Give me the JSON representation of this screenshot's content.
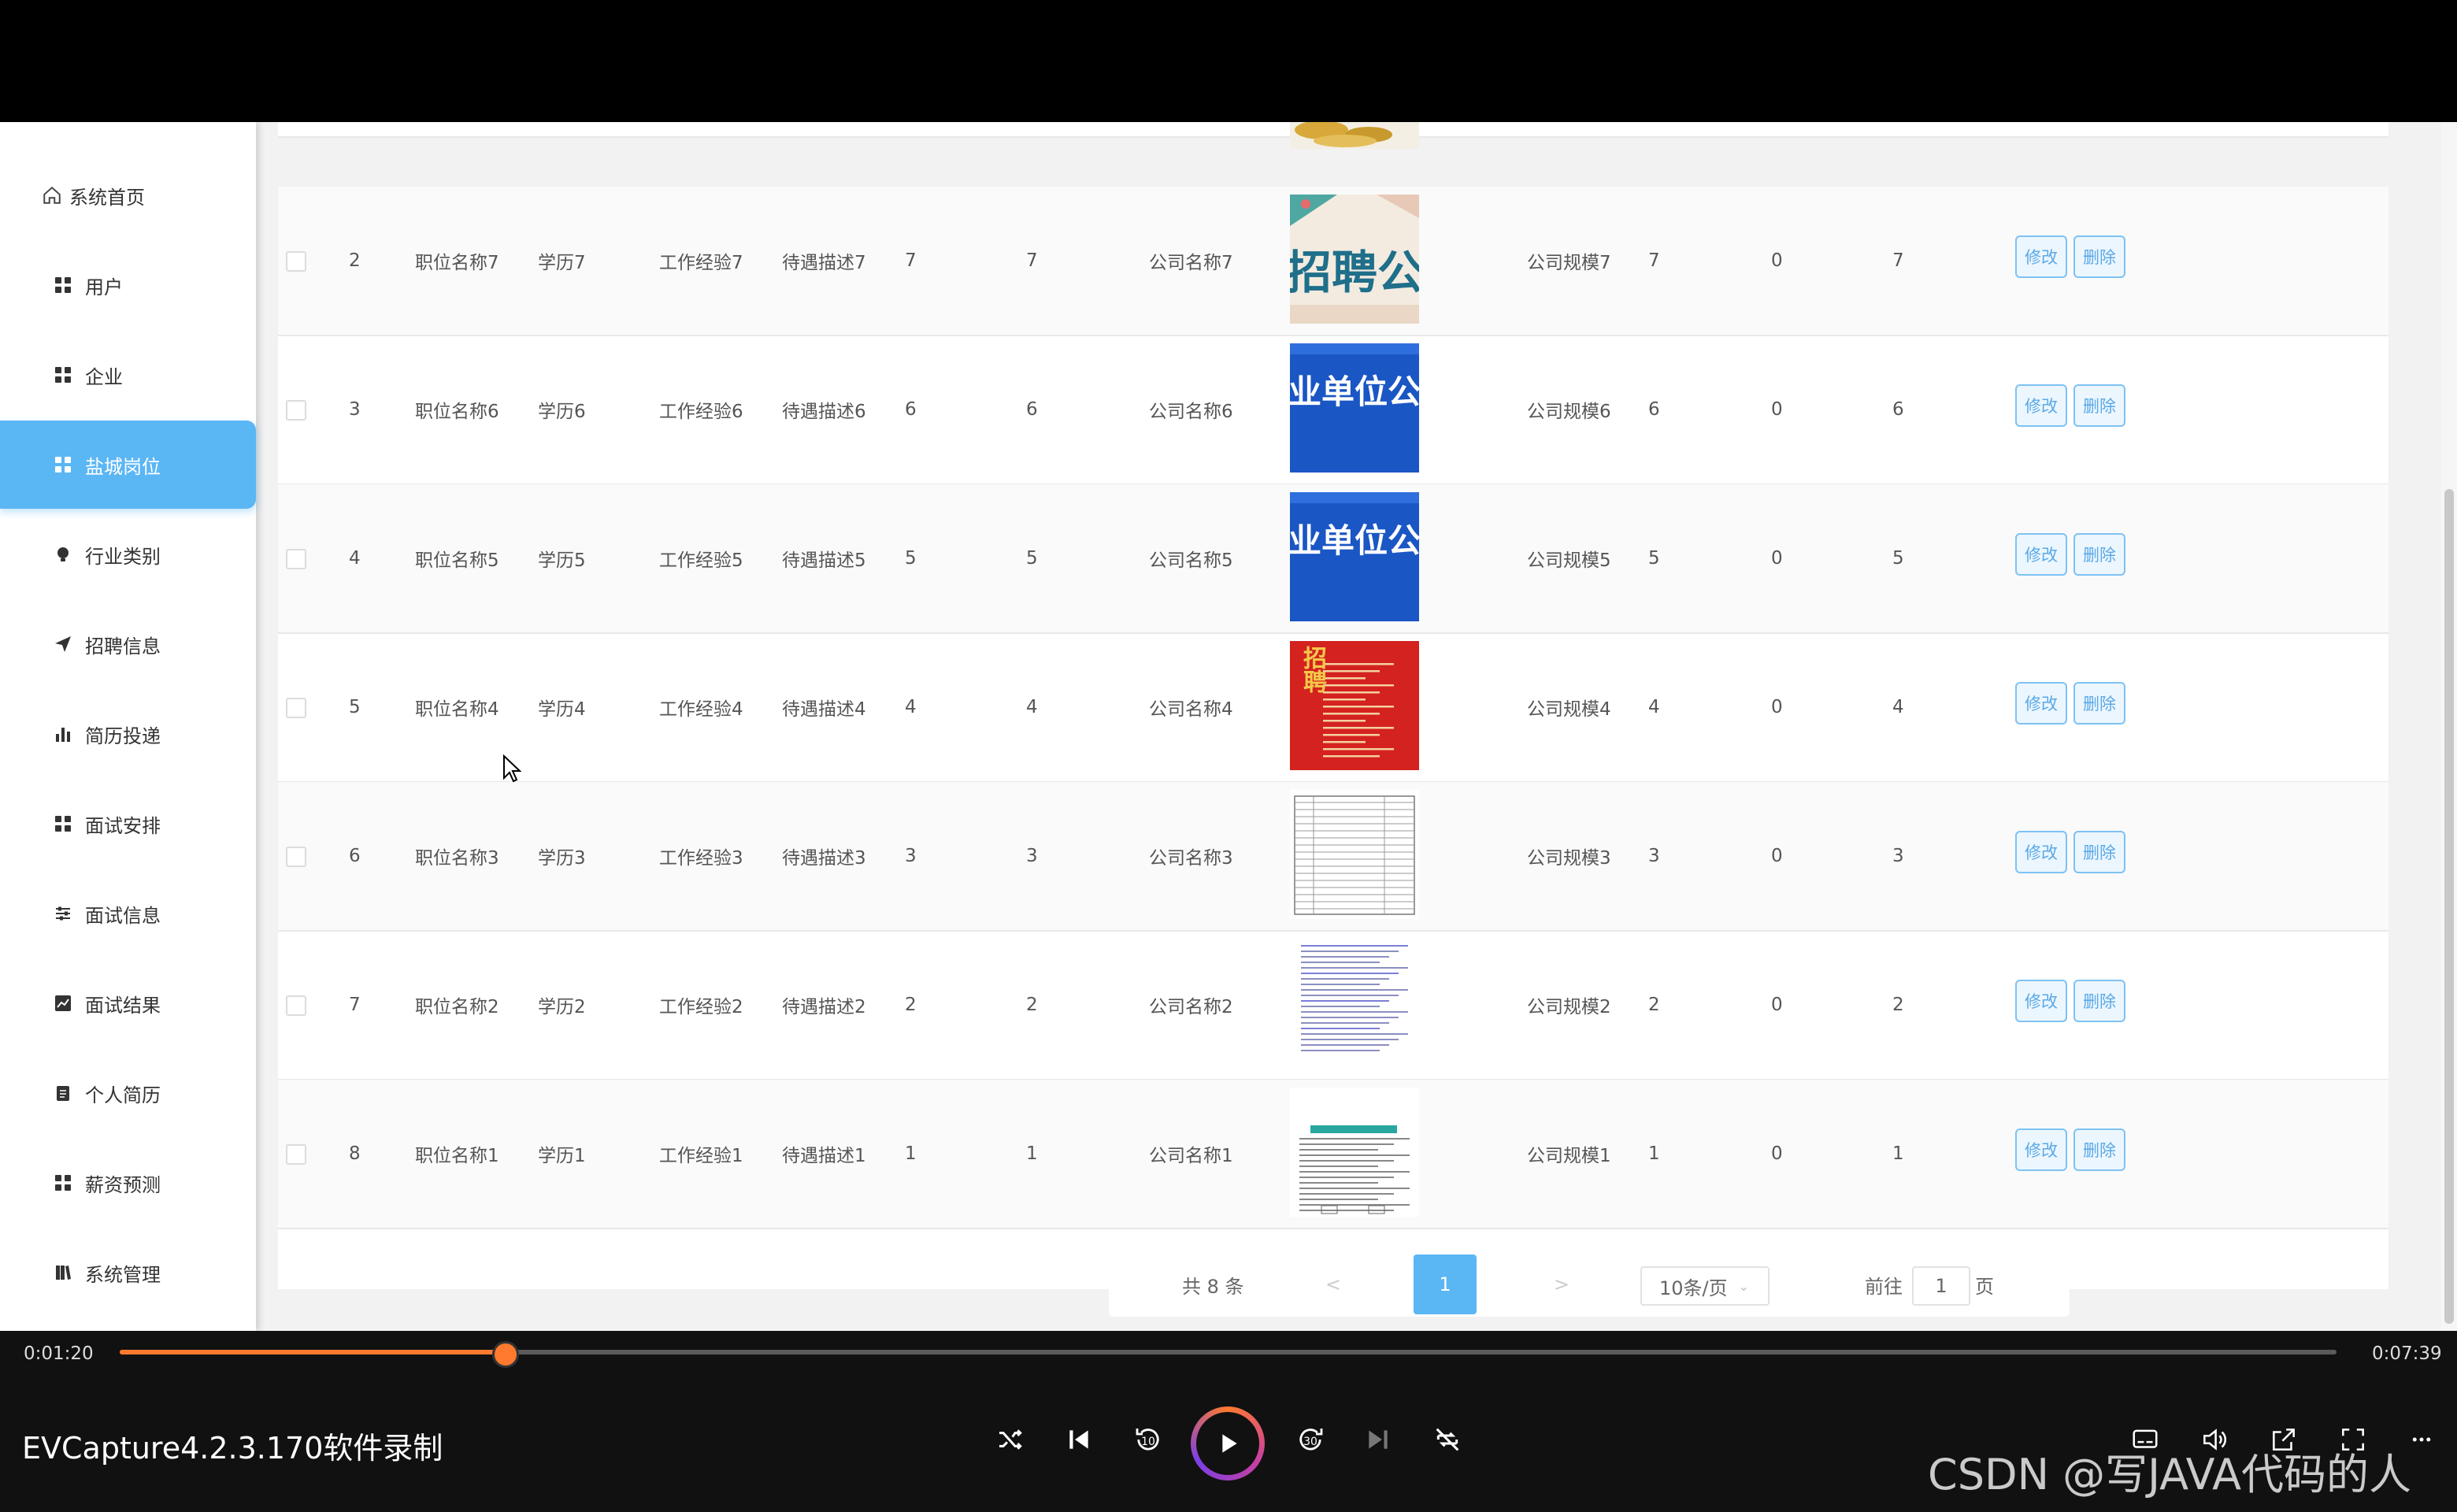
{
  "sidebar": {
    "items": [
      {
        "label": "系统首页",
        "icon": "home-icon"
      },
      {
        "label": "用户",
        "icon": "grid-icon"
      },
      {
        "label": "企业",
        "icon": "grid-icon"
      },
      {
        "label": "盐城岗位",
        "icon": "grid-icon",
        "active": true
      },
      {
        "label": "行业类别",
        "icon": "lightbulb-icon"
      },
      {
        "label": "招聘信息",
        "icon": "paper-plane-icon"
      },
      {
        "label": "简历投递",
        "icon": "bar-chart-icon"
      },
      {
        "label": "面试安排",
        "icon": "grid-icon"
      },
      {
        "label": "面试信息",
        "icon": "sliders-icon"
      },
      {
        "label": "面试结果",
        "icon": "line-chart-icon"
      },
      {
        "label": "个人简历",
        "icon": "clipboard-icon"
      },
      {
        "label": "薪资预测",
        "icon": "grid-icon"
      },
      {
        "label": "系统管理",
        "icon": "book-icon"
      }
    ]
  },
  "table": {
    "rows": [
      {
        "index": "2",
        "title": "职位名称7",
        "edu": "学历7",
        "exp": "工作经验7",
        "benefit": "待遇描述7",
        "n1": "7",
        "n2": "7",
        "company": "公司名称7",
        "scale": "公司规模7",
        "n3": "7",
        "n4": "0",
        "n5": "7",
        "thumb_text": "招聘公",
        "thumb_style": "poster-teal"
      },
      {
        "index": "3",
        "title": "职位名称6",
        "edu": "学历6",
        "exp": "工作经验6",
        "benefit": "待遇描述6",
        "n1": "6",
        "n2": "6",
        "company": "公司名称6",
        "scale": "公司规模6",
        "n3": "6",
        "n4": "0",
        "n5": "6",
        "thumb_text": "业单位公",
        "thumb_style": "poster-blue"
      },
      {
        "index": "4",
        "title": "职位名称5",
        "edu": "学历5",
        "exp": "工作经验5",
        "benefit": "待遇描述5",
        "n1": "5",
        "n2": "5",
        "company": "公司名称5",
        "scale": "公司规模5",
        "n3": "5",
        "n4": "0",
        "n5": "5",
        "thumb_text": "业单位公",
        "thumb_style": "poster-blue"
      },
      {
        "index": "5",
        "title": "职位名称4",
        "edu": "学历4",
        "exp": "工作经验4",
        "benefit": "待遇描述4",
        "n1": "4",
        "n2": "4",
        "company": "公司名称4",
        "scale": "公司规模4",
        "n3": "4",
        "n4": "0",
        "n5": "4",
        "thumb_text": "招聘",
        "thumb_style": "poster-red"
      },
      {
        "index": "6",
        "title": "职位名称3",
        "edu": "学历3",
        "exp": "工作经验3",
        "benefit": "待遇描述3",
        "n1": "3",
        "n2": "3",
        "company": "公司名称3",
        "scale": "公司规模3",
        "n3": "3",
        "n4": "0",
        "n5": "3",
        "thumb_text": "",
        "thumb_style": "doc-table"
      },
      {
        "index": "7",
        "title": "职位名称2",
        "edu": "学历2",
        "exp": "工作经验2",
        "benefit": "待遇描述2",
        "n1": "2",
        "n2": "2",
        "company": "公司名称2",
        "scale": "公司规模2",
        "n3": "2",
        "n4": "0",
        "n5": "2",
        "thumb_text": "",
        "thumb_style": "doc-text"
      },
      {
        "index": "8",
        "title": "职位名称1",
        "edu": "学历1",
        "exp": "工作经验1",
        "benefit": "待遇描述1",
        "n1": "1",
        "n2": "1",
        "company": "公司名称1",
        "scale": "公司规模1",
        "n3": "1",
        "n4": "0",
        "n5": "1",
        "thumb_text": "",
        "thumb_style": "doc-form"
      }
    ],
    "edit_label": "修改",
    "delete_label": "删除"
  },
  "pagination": {
    "total": "共 8 条",
    "prev": "<",
    "current": "1",
    "next": ">",
    "page_size": "10条/页",
    "goto_prefix": "前往",
    "goto_value": "1",
    "goto_suffix": "页"
  },
  "player": {
    "current_time": "0:01:20",
    "total_time": "0:07:39",
    "progress_fraction": 0.174,
    "title": "EVCapture4.2.3.170软件录制",
    "watermark": "CSDN @写JAVA代码的人",
    "accent": "#ff7a2e"
  },
  "colors": {
    "active": "#5bb6f4",
    "button_border": "#7ec2f3"
  }
}
